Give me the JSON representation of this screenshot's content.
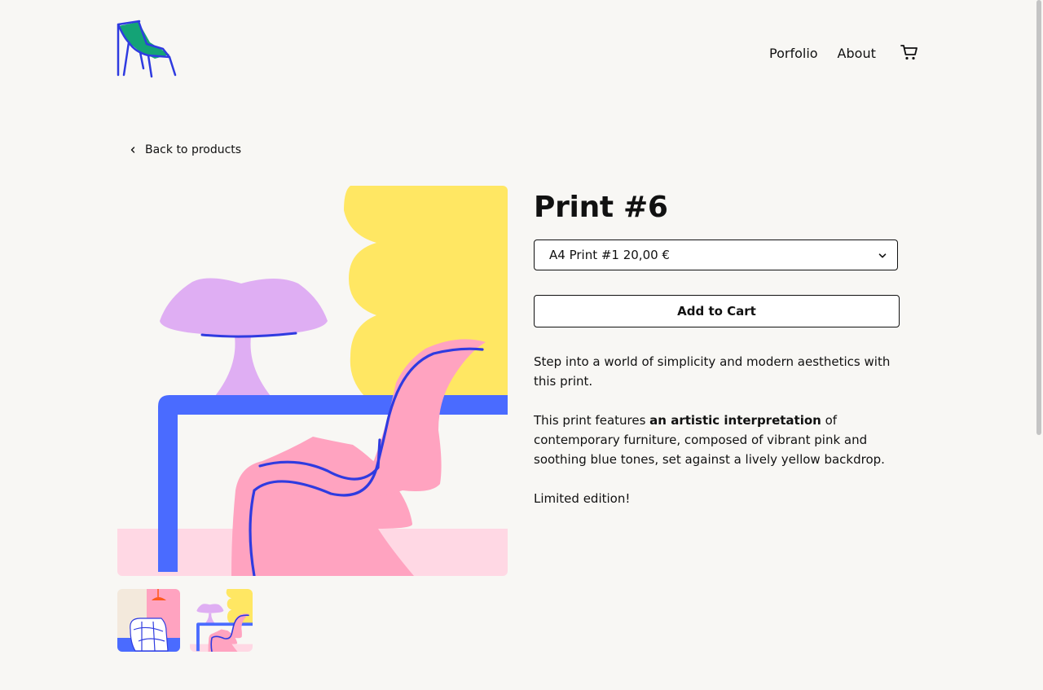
{
  "nav": {
    "portfolio_label": "Porfolio",
    "about_label": "About",
    "cart_icon": "cart-icon"
  },
  "logo": {
    "icon": "chair-logo-icon"
  },
  "back_link": {
    "label": "Back to products",
    "icon": "chevron-left-icon"
  },
  "product": {
    "title": "Print #6",
    "variant_select": {
      "selected": "A4 Print #1 20,00 €",
      "icon": "chevron-down-icon"
    },
    "add_to_cart_label": "Add to Cart",
    "description": {
      "p1": "Step into a world of simplicity and modern aesthetics with this print.",
      "p2_before": "This print features ",
      "p2_bold": "an artistic interpretation",
      "p2_after": " of contemporary furniture, composed of vibrant pink and soothing blue tones, set against a lively yellow backdrop.",
      "p3": "Limited edition!"
    }
  },
  "colors": {
    "background": "#f8f7f4",
    "yellow": "#ffe763",
    "pink": "#ffa3c0",
    "light_pink": "#ffd8e4",
    "lavender": "#dfaef3",
    "blue": "#4a6bff",
    "dark_blue": "#2f3be0",
    "green": "#14a376"
  }
}
